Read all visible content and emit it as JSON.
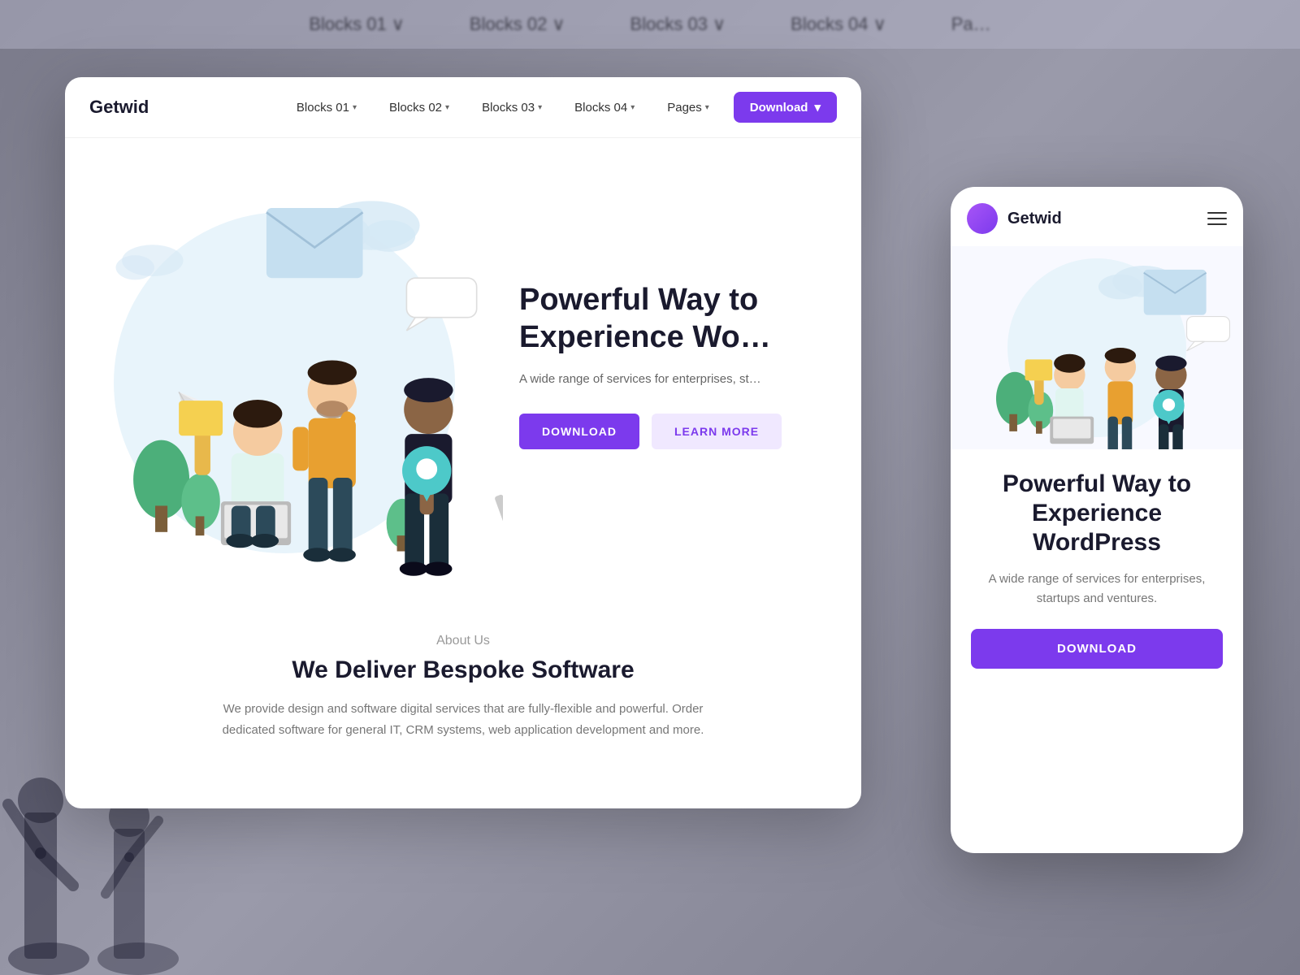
{
  "background": {
    "nav_items": [
      "Blocks 01",
      "Blocks 02",
      "Blocks 03",
      "Blocks 04",
      "Pages"
    ]
  },
  "desktop": {
    "logo": "Getwid",
    "nav": {
      "items": [
        {
          "label": "Blocks 01",
          "has_chevron": true
        },
        {
          "label": "Blocks 02",
          "has_chevron": true
        },
        {
          "label": "Blocks 03",
          "has_chevron": true
        },
        {
          "label": "Blocks 04",
          "has_chevron": true
        },
        {
          "label": "Pages",
          "has_chevron": true
        }
      ],
      "download_label": "Download"
    },
    "hero": {
      "title": "Powerful Way to Experience WordPress",
      "title_truncated": "Powerful Way t… Experience Wo…",
      "subtitle": "A wide range of services for enterprises, st…",
      "btn_primary": "DOWNLOAD",
      "btn_secondary": "LEARN MORE"
    },
    "about": {
      "label": "About Us",
      "title": "We Deliver Bespoke Software",
      "text": "We provide design and software digital services that are fully-flexible and powerful. Order dedicated software for general IT, CRM systems, web application development and more."
    }
  },
  "mobile": {
    "logo": "Getwid",
    "hero": {
      "title": "Powerful Way to Experience WordPress",
      "subtitle": "A wide range of services for enterprises, startups and ventures.",
      "btn_label": "DOWNLOAD"
    }
  },
  "colors": {
    "purple": "#7c3aed",
    "purple_light": "#f0e8ff",
    "dark": "#1a1a2e",
    "gray": "#666666",
    "light_blue": "#e8f4fb"
  }
}
